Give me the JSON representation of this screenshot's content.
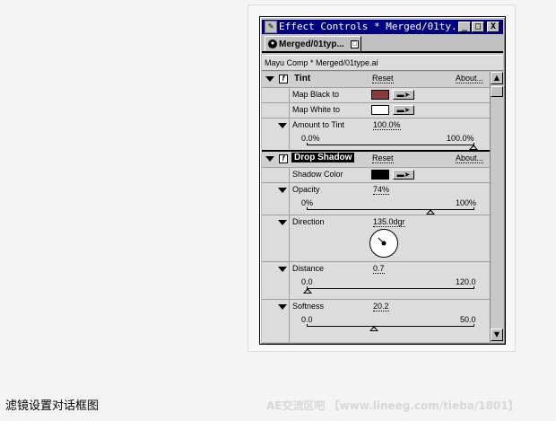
{
  "window": {
    "title": "Effect Controls * Merged/01ty...",
    "tab_label": "Merged/01typ...",
    "comp_path": "Mayu Comp * Merged/01type.ai",
    "controls": {
      "minimize": "_",
      "maximize": "□",
      "close": "X"
    }
  },
  "effects": {
    "tint": {
      "name": "Tint",
      "reset": "Reset",
      "about": "About...",
      "map_black_label": "Map Black to",
      "map_black_color": "#8b3a3a",
      "map_white_label": "Map White to",
      "map_white_color": "#ffffff",
      "amount_label": "Amount to Tint",
      "amount_value": "100.0%",
      "amount_min": "0.0%",
      "amount_max": "100.0%",
      "amount_fraction": 1.0
    },
    "drop_shadow": {
      "name": "Drop Shadow",
      "reset": "Reset",
      "about": "About...",
      "shadow_color_label": "Shadow Color",
      "shadow_color": "#000000",
      "opacity_label": "Opacity",
      "opacity_value": "74%",
      "opacity_min": "0%",
      "opacity_max": "100%",
      "opacity_fraction": 0.74,
      "direction_label": "Direction",
      "direction_value": "135.0dgr",
      "distance_label": "Distance",
      "distance_value": "0.7",
      "distance_min": "0.0",
      "distance_max": "120.0",
      "distance_fraction": 0.006,
      "softness_label": "Softness",
      "softness_value": "20.2",
      "softness_min": "0.0",
      "softness_max": "50.0",
      "softness_fraction": 0.404
    }
  },
  "caption": "滤镜设置对话框图",
  "watermark": "AE交流区吧 【www.lineeg.com/tieba/1801】"
}
